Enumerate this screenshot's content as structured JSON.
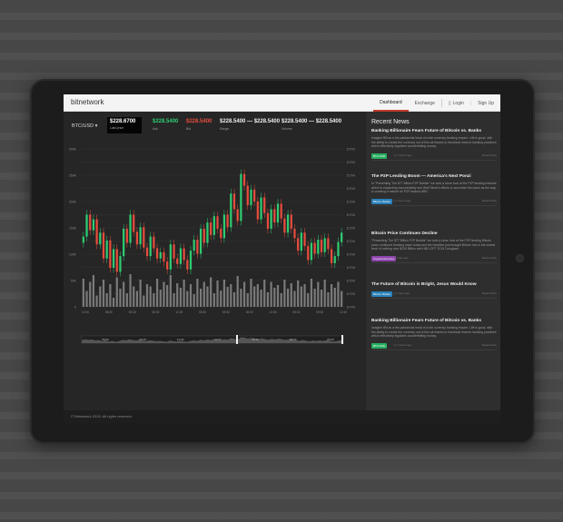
{
  "app": {
    "brand": "bitnetwork",
    "nav": {
      "dashboard": "Dashboard",
      "exchange": "Exchange",
      "login": "Login",
      "signup": "Sign Up"
    }
  },
  "ticker": {
    "pair": "BTC/USD ▾",
    "last_price": "$228.6700",
    "last_label": "Last price",
    "ask_value": "$228.5400",
    "ask_label": "Ask",
    "bid_value": "$228.5400",
    "bid_label": "Bid",
    "range_value": "$228.5400 — $228.5400",
    "range_label": "Range",
    "volume_value": "$228.5400 — $228.5400",
    "volume_label": "Volume"
  },
  "colors": {
    "up": "#2ecc71",
    "down": "#e74c3c",
    "volume": "#7a7a7a",
    "accent": "#c0392b"
  },
  "chart_data": {
    "type": "candlestick",
    "ylabels_left": [
      "300K",
      "250K",
      "200K",
      "150K",
      "100K",
      "50K",
      "0"
    ],
    "ylabels_right": [
      "$ 57M",
      "$ 57M",
      "$ 57M",
      "$ 57M",
      "$ 57M",
      "$ 57M",
      "$ 57M",
      "$ 57M",
      "$ 57M",
      "$ 57M",
      "$ 57M",
      "$ 57M",
      "$ 57M"
    ],
    "xlabels": [
      "12:30",
      "06:30",
      "09:30",
      "06:30",
      "12:30",
      "06:30",
      "09:30",
      "06:30",
      "12:30",
      "06:30",
      "09:30",
      "12:30"
    ],
    "nav_labels": [
      "08:30",
      "09:15",
      "10:30",
      "12:30",
      "10:30",
      "08:30",
      "09:30"
    ],
    "closes": [
      240,
      268,
      248,
      262,
      230,
      245,
      212,
      235,
      200,
      224,
      195,
      215,
      250,
      232,
      268,
      246,
      230,
      252,
      226,
      215,
      240,
      225,
      212,
      220,
      208,
      198,
      230,
      212,
      205,
      225,
      210,
      198,
      222,
      236,
      218,
      250,
      232,
      258,
      242,
      266,
      250,
      238,
      268,
      252,
      295,
      275,
      260,
      320,
      305,
      280,
      300,
      285,
      262,
      290,
      270,
      250,
      275,
      258,
      282,
      263,
      245,
      268,
      250,
      238,
      222,
      245,
      228,
      210,
      232,
      218,
      236,
      220,
      238,
      224,
      206,
      215,
      233,
      245
    ],
    "volume_heights": [
      0.62,
      0.35,
      0.55,
      0.7,
      0.25,
      0.45,
      0.6,
      0.3,
      0.5,
      0.2,
      0.65,
      0.4,
      0.55,
      0.3,
      0.72,
      0.45,
      0.35,
      0.6,
      0.25,
      0.5,
      0.45,
      0.3,
      0.62,
      0.38,
      0.55,
      0.48,
      0.7,
      0.3,
      0.52,
      0.42,
      0.6,
      0.35,
      0.5,
      0.28,
      0.62,
      0.4,
      0.55,
      0.45,
      0.65,
      0.3,
      0.58,
      0.36,
      0.6,
      0.44,
      0.5,
      0.32,
      0.68,
      0.4,
      0.55,
      0.3,
      0.62,
      0.45,
      0.5,
      0.38,
      0.6,
      0.32,
      0.55,
      0.42,
      0.48,
      0.3,
      0.6,
      0.4,
      0.52,
      0.35,
      0.58,
      0.45,
      0.5,
      0.3,
      0.62,
      0.4,
      0.55,
      0.38,
      0.6,
      0.32,
      0.5,
      0.42,
      0.55,
      0.35
    ]
  },
  "news": {
    "title": "Recent News",
    "items": [
      {
        "headline": "Banking Billionaire Fears Future of Bitcoin vs. Banks",
        "body": "Imagine Bill as a the patriarchal head of a fair currency banking empire. Life is good, with the ability to create the currency out of thin air thanks to fractional reserve banking practices which effectively legalizes counterfeiting money.",
        "tag": "BTC-USD",
        "tag_color": "#27ae60",
        "date": "1 month ago",
        "more": "Read Article"
      },
      {
        "headline": "The P2P Lending Boom — America's Next Ponzi",
        "body": "In \"Presenting The $77 Billion P2P Bubble\" we took a close look at the P2P lending markets which is expanding exponentially and Wall Street's efforts to securitize the loans as the way to creating a market for P2P backed ABS.",
        "tag": "Bitcoin Market",
        "tag_color": "#2980b9",
        "date": "2 hours ago",
        "more": "Read Article"
      },
      {
        "headline": "Bitcoin Price Continues Decline",
        "body": "\"Presenting The $77 Billion P2P Bubble\" we took a close look at the P2P lending Bitcoin price continued heading lower today and the headline just brought Bitcoin low to the lowest level of nothing over $230 Billion and HBO-OFT 2015 Coinglass.",
        "tag": "CryptoCurrencies",
        "tag_color": "#8e44ad",
        "date": "1 day ago",
        "more": "Read Article"
      },
      {
        "headline": "The Future of Bitcoin is Bright, Jesus Would Know",
        "body": "",
        "tag": "Bitcoin Market",
        "tag_color": "#2980b9",
        "date": "2 days ago",
        "more": "Read Article"
      },
      {
        "headline": "Banking Billionaire Fears Future of Bitcoin vs. Banks",
        "body": "Imagine Bill as a the patriarchal head of a fair currency banking empire. Life is good, with the ability to create the currency out of thin air thanks to fractional reserve banking practices which effectively legalizes counterfeiting money.",
        "tag": "BTC-USD",
        "tag_color": "#27ae60",
        "date": "1 month ago",
        "more": "Read Article"
      }
    ]
  },
  "footer": "© Bitnetwork 2015. All rights reserved."
}
